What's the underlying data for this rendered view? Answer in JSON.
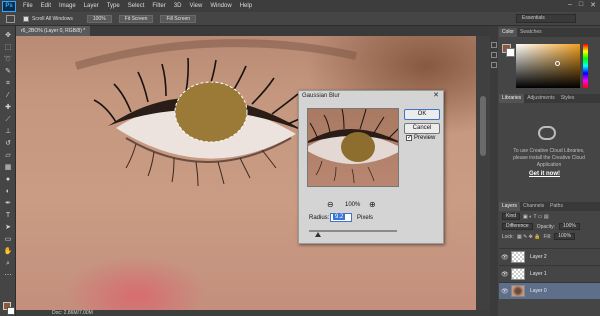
{
  "menubar": {
    "logo": "Ps",
    "items": [
      "File",
      "Edit",
      "Image",
      "Layer",
      "Type",
      "Select",
      "Filter",
      "3D",
      "View",
      "Window",
      "Help"
    ],
    "controls": [
      "–",
      "□",
      "✕"
    ]
  },
  "options_bar": {
    "scroll_all_label": "Scroll All Windows",
    "buttons": [
      "100%",
      "Fit Screen",
      "Fill Screen"
    ],
    "workspace": "Essentials"
  },
  "document": {
    "tab_title": "r6_2BO% (Layer 0, RGB/8) *",
    "status": "Doc: 2.86M/7.00M"
  },
  "dialog": {
    "title": "Gaussian Blur",
    "ok_label": "OK",
    "cancel_label": "Cancel",
    "preview_label": "Preview",
    "preview_checked": true,
    "zoom_percent": "100%",
    "radius_label": "Radius:",
    "radius_value": "9.2",
    "units_label": "Pixels",
    "radius_slider_fraction": 0.1
  },
  "color_panel": {
    "tabs": [
      "Color",
      "Swatches"
    ],
    "foreground": "#8a5a3a",
    "hue": "#f0a020"
  },
  "libraries_panel": {
    "tabs": [
      "Libraries",
      "Adjustments",
      "Styles"
    ],
    "message": "To use Creative Cloud Libraries, please install the Creative Cloud Application",
    "link": "Get it now!"
  },
  "layers_panel": {
    "tabs": [
      "Layers",
      "Channels",
      "Paths"
    ],
    "filter_kind": "Kind",
    "blend_mode": "Difference",
    "opacity_label": "Opacity:",
    "opacity_value": "100%",
    "lock_label": "Lock:",
    "fill_label": "Fill:",
    "fill_value": "100%",
    "layers": [
      {
        "name": "Layer 2",
        "selected": false,
        "thumb": "transparent"
      },
      {
        "name": "Layer 1",
        "selected": false,
        "thumb": "transparent"
      },
      {
        "name": "Layer 0",
        "selected": true,
        "thumb": "photo"
      }
    ]
  }
}
